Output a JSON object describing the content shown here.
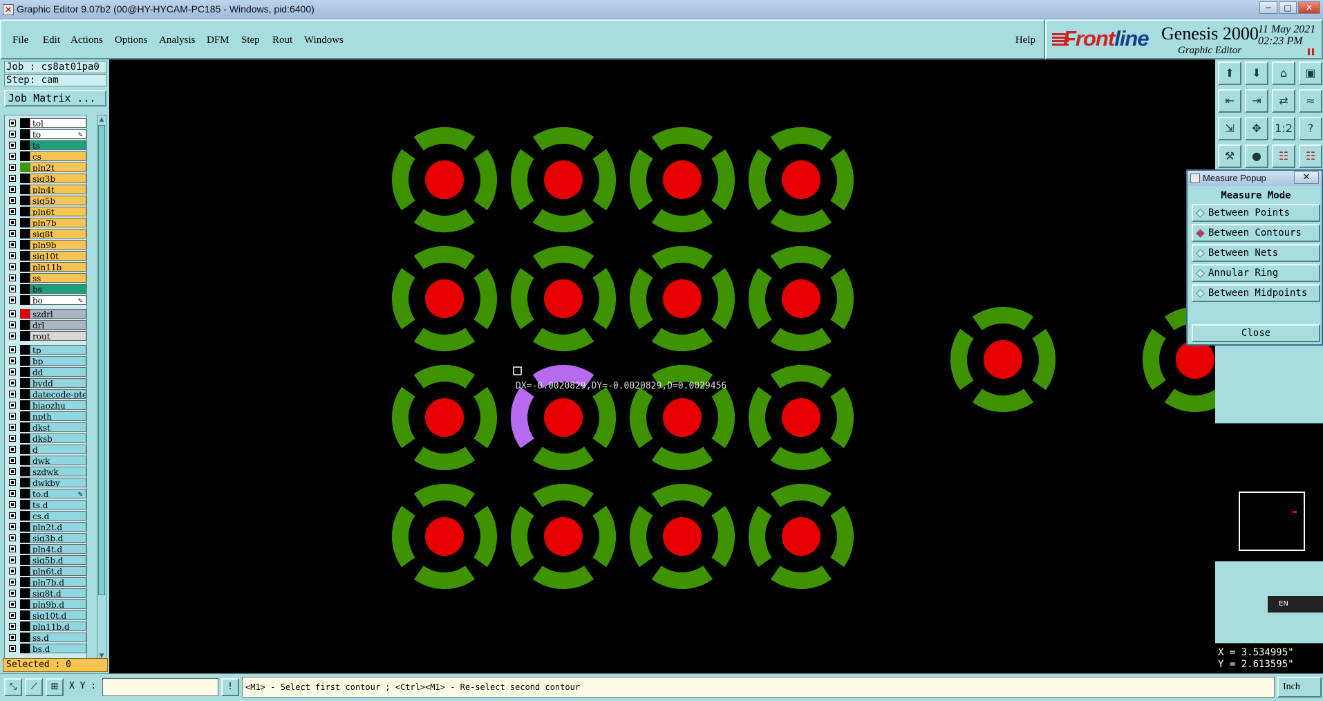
{
  "window": {
    "title": "Graphic Editor 9.07b2 (00@HY-HYCAM-PC185 - Windows, pid:6400)",
    "minimize": "−",
    "maximize": "□",
    "close": "✕"
  },
  "menu": {
    "file": "File",
    "edit": "Edit",
    "actions": "Actions",
    "options": "Options",
    "analysis": "Analysis",
    "dfm": "DFM",
    "step": "Step",
    "rout": "Rout",
    "windows": "Windows",
    "help": "Help"
  },
  "logo": {
    "brand_a": "Front",
    "brand_b": "line",
    "product": "Genesis 2000",
    "subtitle": "Graphic Editor",
    "date": "11 May 2021",
    "time": "02:23 PM"
  },
  "job": {
    "job_label": "Job : cs8at01pa0",
    "step_label": "Step: cam",
    "matrix_button": "Job Matrix ..."
  },
  "layers": [
    {
      "name": "tol",
      "color": "#ffffff",
      "swatch": "#000000",
      "pen": false
    },
    {
      "name": "to",
      "color": "#ffffff",
      "swatch": "#000000",
      "pen": true
    },
    {
      "name": "ts",
      "color": "#1aa07a",
      "swatch": "#000000",
      "pen": false
    },
    {
      "name": "cs",
      "color": "#f5c452",
      "swatch": "#000000",
      "pen": false
    },
    {
      "name": "pln2t",
      "color": "#f5c452",
      "swatch": "#3a9a00",
      "pen": false
    },
    {
      "name": "sig3b",
      "color": "#f5c452",
      "swatch": "#000000",
      "pen": false
    },
    {
      "name": "pln4t",
      "color": "#f5c452",
      "swatch": "#000000",
      "pen": false
    },
    {
      "name": "sig5b",
      "color": "#f5c452",
      "swatch": "#000000",
      "pen": false
    },
    {
      "name": "pln6t",
      "color": "#f5c452",
      "swatch": "#000000",
      "pen": false
    },
    {
      "name": "pln7b",
      "color": "#f5c452",
      "swatch": "#000000",
      "pen": false
    },
    {
      "name": "sig8t",
      "color": "#f5c452",
      "swatch": "#000000",
      "pen": false
    },
    {
      "name": "pln9b",
      "color": "#f5c452",
      "swatch": "#000000",
      "pen": false
    },
    {
      "name": "sig10t",
      "color": "#f5c452",
      "swatch": "#000000",
      "pen": false
    },
    {
      "name": "pln11b",
      "color": "#f5c452",
      "swatch": "#000000",
      "pen": false
    },
    {
      "name": "ss",
      "color": "#f5c452",
      "swatch": "#000000",
      "pen": false
    },
    {
      "name": "bs",
      "color": "#1aa07a",
      "swatch": "#000000",
      "pen": false
    },
    {
      "name": "bo",
      "color": "#ffffff",
      "swatch": "#000000",
      "pen": true
    },
    {
      "name": "szdrl",
      "color": "#a9b6c4",
      "swatch": "#e00000",
      "pen": false,
      "gap": true
    },
    {
      "name": "drl",
      "color": "#a9b6c4",
      "swatch": "#000000",
      "pen": false
    },
    {
      "name": "rout",
      "color": "#d8d8d8",
      "swatch": "#000000",
      "pen": false
    },
    {
      "name": "tp",
      "color": "#8fd6e0",
      "swatch": "#000000",
      "pen": false,
      "gap": true
    },
    {
      "name": "bp",
      "color": "#8fd6e0",
      "swatch": "#000000",
      "pen": false
    },
    {
      "name": "dd",
      "color": "#8fd6e0",
      "swatch": "#000000",
      "pen": false
    },
    {
      "name": "bydd",
      "color": "#8fd6e0",
      "swatch": "#000000",
      "pen": false
    },
    {
      "name": "datecode-pte",
      "color": "#8fd6e0",
      "swatch": "#000000",
      "pen": false
    },
    {
      "name": "biaozhu",
      "color": "#8fd6e0",
      "swatch": "#000000",
      "pen": false
    },
    {
      "name": "npth",
      "color": "#8fd6e0",
      "swatch": "#000000",
      "pen": false
    },
    {
      "name": "dkst",
      "color": "#8fd6e0",
      "swatch": "#000000",
      "pen": false
    },
    {
      "name": "dksb",
      "color": "#8fd6e0",
      "swatch": "#000000",
      "pen": false
    },
    {
      "name": "d",
      "color": "#8fd6e0",
      "swatch": "#000000",
      "pen": false
    },
    {
      "name": "dwk",
      "color": "#8fd6e0",
      "swatch": "#000000",
      "pen": false
    },
    {
      "name": "szdwk",
      "color": "#8fd6e0",
      "swatch": "#000000",
      "pen": false
    },
    {
      "name": "dwkby",
      "color": "#8fd6e0",
      "swatch": "#000000",
      "pen": false
    },
    {
      "name": "to.d",
      "color": "#8fd6e0",
      "swatch": "#000000",
      "pen": true
    },
    {
      "name": "ts.d",
      "color": "#8fd6e0",
      "swatch": "#000000",
      "pen": false
    },
    {
      "name": "cs.d",
      "color": "#8fd6e0",
      "swatch": "#000000",
      "pen": false
    },
    {
      "name": "pln2t.d",
      "color": "#8fd6e0",
      "swatch": "#000000",
      "pen": false
    },
    {
      "name": "sig3b.d",
      "color": "#8fd6e0",
      "swatch": "#000000",
      "pen": false
    },
    {
      "name": "pln4t.d",
      "color": "#8fd6e0",
      "swatch": "#000000",
      "pen": false
    },
    {
      "name": "sig5b.d",
      "color": "#8fd6e0",
      "swatch": "#000000",
      "pen": false
    },
    {
      "name": "pln6t.d",
      "color": "#8fd6e0",
      "swatch": "#000000",
      "pen": false
    },
    {
      "name": "pln7b.d",
      "color": "#8fd6e0",
      "swatch": "#000000",
      "pen": false
    },
    {
      "name": "sig8t.d",
      "color": "#8fd6e0",
      "swatch": "#000000",
      "pen": false
    },
    {
      "name": "pln9b.d",
      "color": "#8fd6e0",
      "swatch": "#000000",
      "pen": false
    },
    {
      "name": "sig10t.d",
      "color": "#8fd6e0",
      "swatch": "#000000",
      "pen": false
    },
    {
      "name": "pln11b.d",
      "color": "#8fd6e0",
      "swatch": "#000000",
      "pen": false
    },
    {
      "name": "ss.d",
      "color": "#8fd6e0",
      "swatch": "#000000",
      "pen": false
    },
    {
      "name": "bs.d",
      "color": "#8fd6e0",
      "swatch": "#000000",
      "pen": false
    }
  ],
  "selected_label": "Selected : 0",
  "canvas": {
    "measure_readout": "DX=-0.0020829,DY=-0.0020829,D=0.0029456",
    "pad_color": "#e60000",
    "thermal_color": "#3f9200",
    "highlight_color": "#b66af0"
  },
  "popup": {
    "title": "Measure Popup",
    "close_x": "✕",
    "heading": "Measure Mode",
    "options": [
      {
        "label": "Between Points",
        "selected": false
      },
      {
        "label": "Between Contours",
        "selected": true
      },
      {
        "label": "Between Nets",
        "selected": false
      },
      {
        "label": "Annular Ring",
        "selected": false
      },
      {
        "label": "Between Midpoints",
        "selected": false
      }
    ],
    "close_button": "Close"
  },
  "toolbar_icons": [
    "layer-up-icon",
    "layer-down-icon",
    "home-icon",
    "window-icon",
    "import-icon",
    "export-icon",
    "swap-icon",
    "snap-icon",
    "zoom-fit-icon",
    "zoom-in-icon",
    "scale-1-2-icon",
    "help-icon",
    "measure-icon",
    "pin-icon",
    "net-icon",
    "net-red-icon"
  ],
  "toolbar_glyphs": [
    "⬆",
    "⬇",
    "⌂",
    "▣",
    "⇤",
    "⇥",
    "⇄",
    "≈",
    "⇲",
    "✥",
    "1:2",
    "?",
    "⚒",
    "●",
    "☷",
    "☷"
  ],
  "coords": {
    "x": "X = 3.534995\"",
    "y": "Y = 2.613595\""
  },
  "lang_label": "EN",
  "bottom": {
    "xy_label": "X Y :",
    "xy_value": "",
    "status": "<M1> - Select first contour ; <Ctrl><M1> - Re-select second contour",
    "units": "Inch"
  }
}
